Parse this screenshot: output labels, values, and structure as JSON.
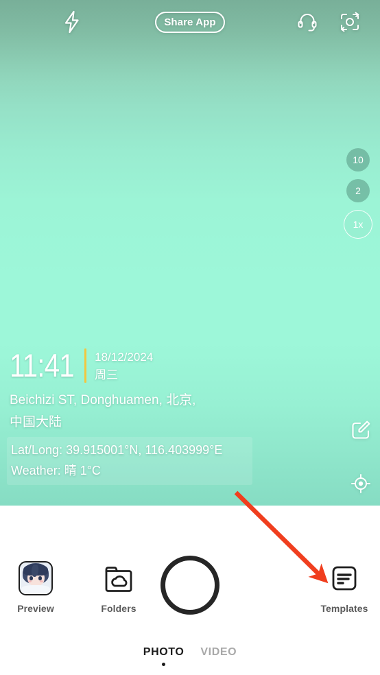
{
  "app": {
    "screen_name": "camera-viewfinder",
    "accent_colors": {
      "viewfinder_top": "#7fb7a0",
      "viewfinder_mid": "#9df7d9",
      "viewfinder_bottom": "#86dcc3",
      "annotation_arrow": "#f03e1e",
      "stamp_divider": "#f2c63f",
      "shutter_ring": "#262626",
      "label_text": "#5a5a5a"
    }
  },
  "topbar": {
    "flash_icon": "flash-bolt-icon",
    "share_app_label": "Share App",
    "headset_icon": "headset-support-icon",
    "camera_flip_icon": "camera-flip-icon"
  },
  "zoom_controls": {
    "options": [
      {
        "label": "10",
        "active": false
      },
      {
        "label": "2",
        "active": false
      },
      {
        "label": "1x",
        "active": true
      }
    ]
  },
  "side_actions": {
    "edit_stamp_icon": "edit-pencil-square-icon",
    "gps_icon": "gps-crosshair-icon"
  },
  "watermark": {
    "time": "11:41",
    "date": "18/12/2024",
    "weekday": "周三",
    "location": "Beichizi ST, Donghuamen, 北京, 中国大陆",
    "latlong": "Lat/Long: 39.915001°N, 116.403999°E",
    "weather": "Weather: 晴 1°C"
  },
  "bottom_shelf": {
    "preview": {
      "label": "Preview",
      "icon": "photo-thumbnail-avatar"
    },
    "folders": {
      "label": "Folders",
      "icon": "folder-cloud-icon"
    },
    "shutter": {
      "icon": "shutter-ring-icon"
    },
    "templates": {
      "label": "Templates",
      "icon": "template-document-icon"
    }
  },
  "mode_tabs": {
    "tabs": [
      {
        "label": "PHOTO",
        "active": true
      },
      {
        "label": "VIDEO",
        "active": false
      }
    ]
  },
  "annotation": {
    "arrow_target": "templates-button"
  }
}
